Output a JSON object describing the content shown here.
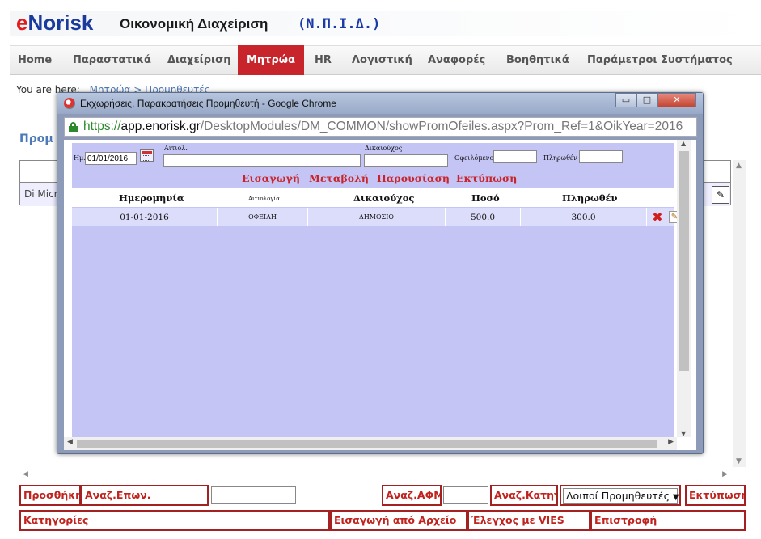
{
  "header": {
    "logo_e": "e",
    "logo_rest": "Norisk",
    "title": "Οικονομική Διαχείριση",
    "subtitle": "(Ν.Π.Ι.Δ.)"
  },
  "nav": {
    "items": [
      "Home",
      "Παραστατικά",
      "Διαχείριση",
      "Μητρώα",
      "HR",
      "Λογιστική",
      "Αναφορές",
      "Βοηθητικά",
      "Παράμετροι Συστήματος"
    ],
    "active": "Μητρώα"
  },
  "breadcrumb": {
    "prefix": "You are here:",
    "path": "Μητρώα > Προμηθευτές"
  },
  "page_heading": "Προμ",
  "background_row_cell": "Di Micr",
  "popup": {
    "title": "Εκχωρήσεις, Παρακρατήσεις Προμηθευτή - Google Chrome",
    "url_scheme": "https://",
    "url_host": "app.enorisk.gr",
    "url_path": "/DesktopModules/DM_COMMON/showPromOfeiles.aspx?Prom_Ref=1&OikYear=2016",
    "window_buttons": {
      "minimize": "▭",
      "restore": "□",
      "close": "✕"
    },
    "form": {
      "date_label": "Ημ.",
      "date_value": "01/01/2016",
      "aitiol_label": "Αιτιολ.",
      "aitiol_value": "",
      "dikaiouxos_label": "Δικαιούχος",
      "dikaiouxos_value": "",
      "ofeilomeno_label": "Οφειλόμενο",
      "ofeilomeno_value": "",
      "plirothen_label": "Πληρωθέν",
      "plirothen_value": ""
    },
    "actions": [
      "Εισαγωγή",
      "Μεταβολή",
      "Παρουσίαση",
      "Εκτύπωση"
    ],
    "columns": [
      "Ημερομηνία",
      "Αιτιολογία",
      "Δικαιούχος",
      "Ποσό",
      "Πληρωθέν"
    ],
    "rows": [
      {
        "date": "01-01-2016",
        "reason": "ΟΦΕΙΛΗ",
        "beneficiary": "ΔΗΜΟΣΙΟ",
        "amount": "500.0",
        "paid": "300.0"
      }
    ]
  },
  "bottom": {
    "add": "Προσθήκη",
    "search_name": "Αναζ.Επων.",
    "search_name_value": "",
    "search_afm": "Αναζ.ΑΦΜ",
    "search_afm_value": "",
    "search_category": "Αναζ.Κατηγ.",
    "category_selected": "Λοιποί Προμηθευτές",
    "print": "Εκτύπωση",
    "categories": "Κατηγορίες",
    "import_file": "Εισαγωγή από Αρχείο",
    "vies_check": "Έλεγχος με VIES",
    "back": "Επιστροφή"
  },
  "colors": {
    "accent": "#c8242b",
    "brand_blue": "#1a3a9e",
    "grid_bg": "#c5c5f5"
  }
}
